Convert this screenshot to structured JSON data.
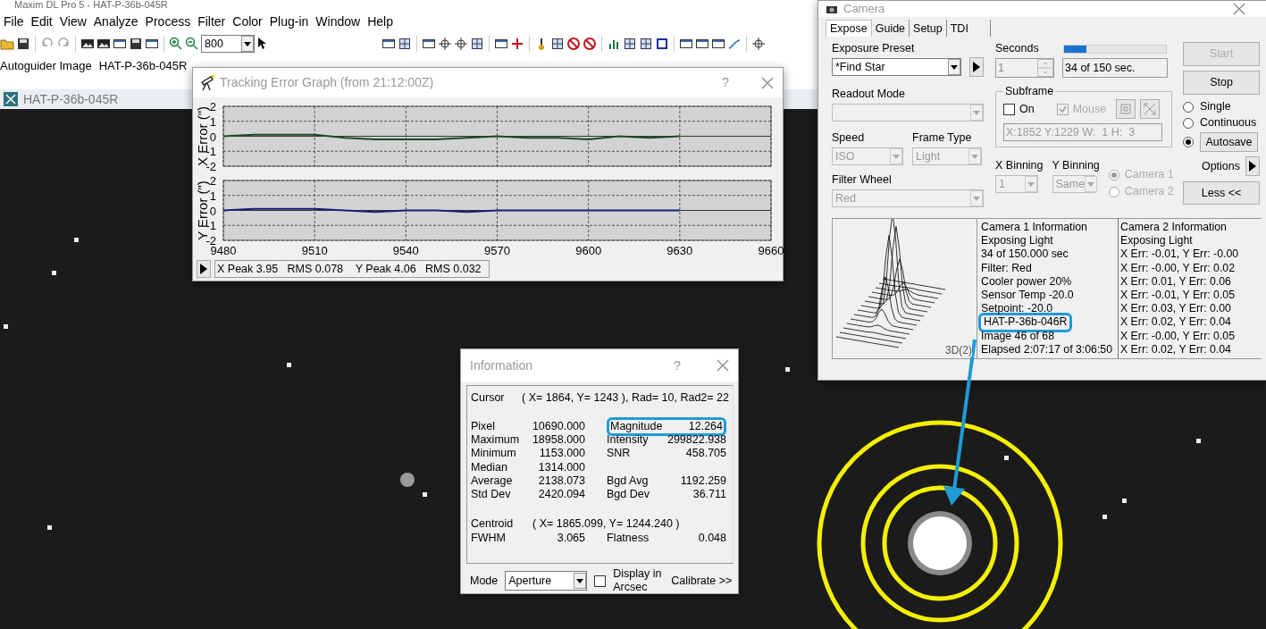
{
  "app": {
    "title": "Maxim DL Pro 5 - HAT-P-36b-045R",
    "menu": [
      {
        "label": "File"
      },
      {
        "label": "Edit"
      },
      {
        "label": "View"
      },
      {
        "label": "Analyze"
      },
      {
        "label": "Process"
      },
      {
        "label": "Filter"
      },
      {
        "label": "Color"
      },
      {
        "label": "Plug-in"
      },
      {
        "label": "Window"
      },
      {
        "label": "Help"
      }
    ],
    "zoom": "800",
    "autoguider": {
      "label": "Autoguider Image",
      "image": "HAT-P-36b-045R"
    },
    "image_window": {
      "title": "HAT-P-36b-045R"
    }
  },
  "tracking_graph": {
    "title": "Tracking Error Graph (from 21:12:00Z)",
    "help": "?",
    "charts": [
      {
        "chart_data": {
          "type": "line",
          "grid": true,
          "ylabel": "X Error (\")",
          "x": [
            9480,
            9490,
            9500,
            9510,
            9520,
            9530,
            9540,
            9550,
            9560,
            9570,
            9580,
            9590,
            9600,
            9610,
            9620,
            9630
          ],
          "xlim": [
            9480,
            9660
          ],
          "ylim": [
            -2,
            2
          ],
          "yticks": [
            -2,
            -1,
            0,
            1,
            2
          ],
          "series": [
            {
              "color": "#1f4a1f",
              "values": [
                0,
                0.1,
                0.1,
                0.1,
                -0.1,
                -0.2,
                -0.2,
                -0.2,
                -0.1,
                0,
                -0.1,
                -0.1,
                -0.2,
                0,
                -0.1,
                0
              ]
            }
          ]
        }
      },
      {
        "chart_data": {
          "type": "line",
          "grid": true,
          "ylabel": "Y Error (\")",
          "x": [
            9480,
            9490,
            9500,
            9510,
            9520,
            9530,
            9540,
            9550,
            9560,
            9570,
            9580,
            9590,
            9600,
            9610,
            9620,
            9630
          ],
          "xlim": [
            9480,
            9660
          ],
          "ylim": [
            -2,
            2
          ],
          "yticks": [
            -2,
            -1,
            0,
            1,
            2
          ],
          "xticks": [
            9480,
            9510,
            9540,
            9570,
            9600,
            9630,
            9660
          ],
          "series": [
            {
              "color": "#1c1c78",
              "values": [
                0,
                0.1,
                0.1,
                0.1,
                0,
                -0.1,
                0,
                0,
                -0.1,
                0,
                0,
                0,
                0,
                0,
                0,
                0
              ]
            }
          ]
        }
      }
    ],
    "readout": "X Peak 3.95   RMS 0.078    Y Peak 4.06   RMS 0.032"
  },
  "camera_window": {
    "title": "Camera",
    "tabs": [
      {
        "label": "Expose",
        "selected": true
      },
      {
        "label": "Guide",
        "selected": false
      },
      {
        "label": "Setup",
        "selected": false
      },
      {
        "label": "TDI",
        "selected": false
      }
    ],
    "exposure_preset": {
      "label": "Exposure Preset",
      "value": "*Find Star",
      "disabled": false
    },
    "readout_mode": {
      "label": "Readout Mode",
      "disabled": true
    },
    "speed": {
      "label": "Speed",
      "value": "ISO",
      "disabled": true
    },
    "frame_type": {
      "label": "Frame Type",
      "value": "Light",
      "disabled": true
    },
    "filter_wheel": {
      "label": "Filter Wheel",
      "value": "Red",
      "disabled": true
    },
    "seconds": {
      "label": "Seconds",
      "value": "1",
      "disabled": true
    },
    "progress": {
      "level": 0.22,
      "reading": "34 of 150 sec."
    },
    "subframe": {
      "label": "Subframe",
      "on": {
        "label": "On",
        "checked": false,
        "disabled": false
      },
      "mouse": {
        "label": "Mouse",
        "checked": true,
        "disabled": true
      },
      "readout": "X:1852 Y:1229 W:  1 H:  3"
    },
    "x_binning": {
      "label": "X Binning",
      "value": "1",
      "disabled": true
    },
    "y_binning": {
      "label": "Y Binning",
      "value": "Same",
      "disabled": true
    },
    "cameras": [
      {
        "label": "Camera 1",
        "selected": true,
        "disabled": true
      },
      {
        "label": "Camera 2",
        "selected": false,
        "disabled": true
      }
    ],
    "start": {
      "label": "Start",
      "disabled": true
    },
    "stop": {
      "label": "Stop",
      "disabled": false
    },
    "modes": [
      {
        "label": "Single",
        "selected": false,
        "kind": "plain"
      },
      {
        "label": "Continuous",
        "selected": false,
        "kind": "plain"
      },
      {
        "label": "Autosave",
        "selected": true,
        "kind": "button"
      }
    ],
    "options": "Options",
    "less": "Less <<",
    "profile_label": "3D(2)",
    "camera_1_info": [
      {
        "text": "Camera 1 Information",
        "highlighted": false
      },
      {
        "text": "Exposing Light",
        "highlighted": false
      },
      {
        "text": "34 of 150.000 sec",
        "highlighted": false
      },
      {
        "text": "Filter: Red",
        "highlighted": false
      },
      {
        "text": "Cooler power 20%",
        "highlighted": false
      },
      {
        "text": "Sensor Temp -20.0",
        "highlighted": false
      },
      {
        "text": "Setpoint: -20.0",
        "highlighted": false
      },
      {
        "text": "HAT-P-36b-046R",
        "highlighted": true
      },
      {
        "text": "Image 46 of 68",
        "highlighted": false
      },
      {
        "text": "Elapsed 2:07:17 of 3:06:50",
        "highlighted": false
      }
    ],
    "camera_2_info": [
      "Camera 2 Information",
      "Exposing Light",
      "X Err: -0.01, Y Err: -0.00",
      "X Err: -0.00, Y Err: 0.02",
      "X Err: 0.01, Y Err: 0.06",
      "X Err: -0.01, Y Err: 0.05",
      "X Err: 0.03, Y Err: 0.00",
      "X Err: 0.02, Y Err: 0.04",
      "X Err: -0.00, Y Err: 0.05",
      "X Err: 0.02, Y Err: 0.04"
    ]
  },
  "info_window": {
    "title": "Information",
    "help": "?",
    "cursor": {
      "label": "Cursor",
      "value": "( X= 1864, Y= 1243 ), Rad= 10, Rad2= 22"
    },
    "stats": [
      {
        "left": {
          "label": "Pixel",
          "value": "10690.000"
        },
        "right": {
          "label": "Magnitude",
          "value": "12.264",
          "highlighted": true
        }
      },
      {
        "left": {
          "label": "Maximum",
          "value": "18958.000"
        },
        "right": {
          "label": "Intensity",
          "value": "299822.938",
          "highlighted": false
        }
      },
      {
        "left": {
          "label": "Minimum",
          "value": "1153.000"
        },
        "right": {
          "label": "SNR",
          "value": "458.705",
          "highlighted": false
        }
      },
      {
        "left": {
          "label": "Median",
          "value": "1314.000"
        }
      },
      {
        "left": {
          "label": "Average",
          "value": "2138.073"
        },
        "right": {
          "label": "Bgd Avg",
          "value": "1192.259",
          "highlighted": false
        }
      },
      {
        "left": {
          "label": "Std Dev",
          "value": "2420.094"
        },
        "right": {
          "label": "Bgd Dev",
          "value": "36.711",
          "highlighted": false
        }
      }
    ],
    "centroid": {
      "label": "Centroid",
      "value": "( X= 1865.099, Y= 1244.240 )"
    },
    "fwhm": {
      "left": {
        "label": "FWHM",
        "value": "3.065"
      },
      "right": {
        "label": "Flatness",
        "value": "0.048",
        "highlighted": false
      }
    },
    "mode": {
      "label": "Mode",
      "value": "Aperture"
    },
    "arcsec": {
      "label": "Display in Arcsec",
      "checked": false
    },
    "calibrate": "Calibrate >>"
  }
}
